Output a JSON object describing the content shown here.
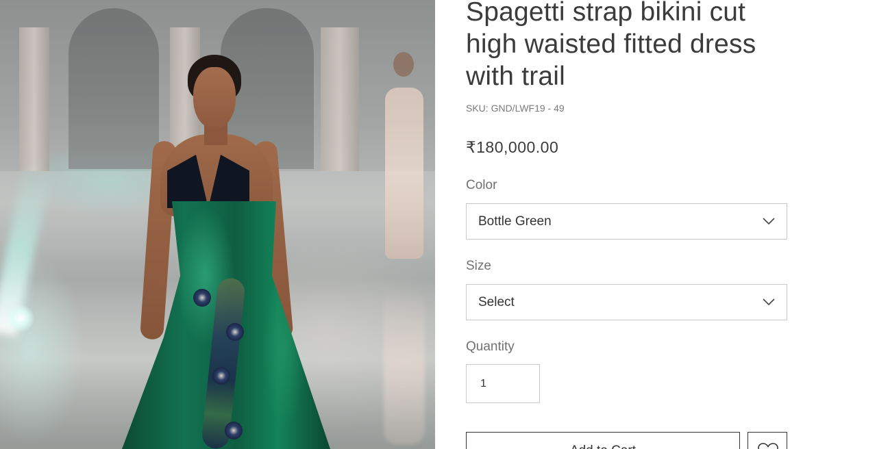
{
  "product": {
    "title": "Spagetti strap bikini cut high waisted fitted dress with trail",
    "sku": "SKU: GND/LWF19 - 49",
    "price": "₹180,000.00"
  },
  "options": {
    "color": {
      "label": "Color",
      "selected": "Bottle Green"
    },
    "size": {
      "label": "Size",
      "selected": "Select"
    },
    "quantity": {
      "label": "Quantity",
      "value": "1"
    }
  },
  "actions": {
    "add_to_cart_label": "Add to Cart"
  },
  "icons": {
    "dropdown": "chevron-down-icon",
    "wishlist": "heart-icon"
  },
  "colors": {
    "text": "#333333",
    "muted": "#7a7a7a",
    "border": "#c8c8c8",
    "dress": "#0f5e42"
  }
}
